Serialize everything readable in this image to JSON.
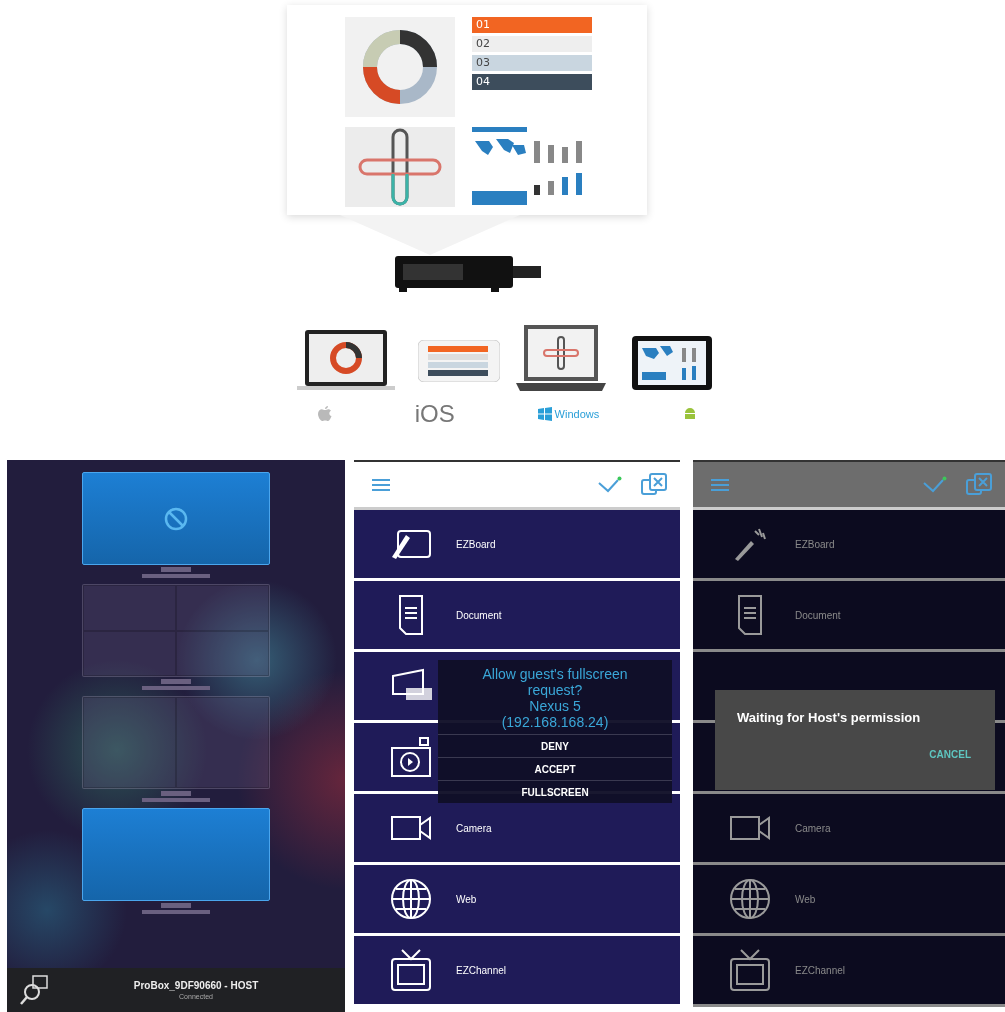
{
  "illustration": {
    "infographic_steps": [
      "01",
      "02",
      "03",
      "04"
    ],
    "platforms": [
      {
        "kind": "apple"
      },
      {
        "kind": "text",
        "label": "iOS"
      },
      {
        "kind": "windows",
        "label": "Windows"
      },
      {
        "kind": "android"
      }
    ]
  },
  "host_screen": {
    "monitors": [
      {
        "kind": "blocked",
        "selected": true
      },
      {
        "kind": "quad",
        "selected": false
      },
      {
        "kind": "dual",
        "selected": false
      },
      {
        "kind": "single",
        "selected": true
      }
    ],
    "device_name": "ProBox_9DF90660 - HOST",
    "status": "Connected"
  },
  "menu_screens": [
    {
      "dimmed": false,
      "items": [
        {
          "kind": "whiteboard",
          "label": "EZBoard"
        },
        {
          "kind": "document",
          "label": "Document"
        },
        {
          "kind": "airview"
        },
        {
          "kind": "photo"
        },
        {
          "kind": "camera",
          "label": "Camera"
        },
        {
          "kind": "web",
          "label": "Web"
        },
        {
          "kind": "channel",
          "label": "EZChannel"
        }
      ],
      "dialog": {
        "kind": "request",
        "message": [
          "Allow guest's fullscreen request?",
          "Nexus 5",
          "(192.168.168.24)"
        ],
        "buttons": [
          "DENY",
          "ACCEPT",
          "FULLSCREEN"
        ]
      }
    },
    {
      "dimmed": true,
      "items": [
        {
          "kind": "pen",
          "label": "EZBoard"
        },
        {
          "kind": "document",
          "label": "Document"
        },
        {
          "kind": "blank"
        },
        {
          "kind": "blank"
        },
        {
          "kind": "camera",
          "label": "Camera"
        },
        {
          "kind": "web",
          "label": "Web"
        },
        {
          "kind": "channel",
          "label": "EZChannel"
        }
      ],
      "dialog": {
        "kind": "waiting",
        "message": [
          "Waiting for Host's permission"
        ],
        "buttons": [
          "CANCEL"
        ]
      }
    }
  ]
}
